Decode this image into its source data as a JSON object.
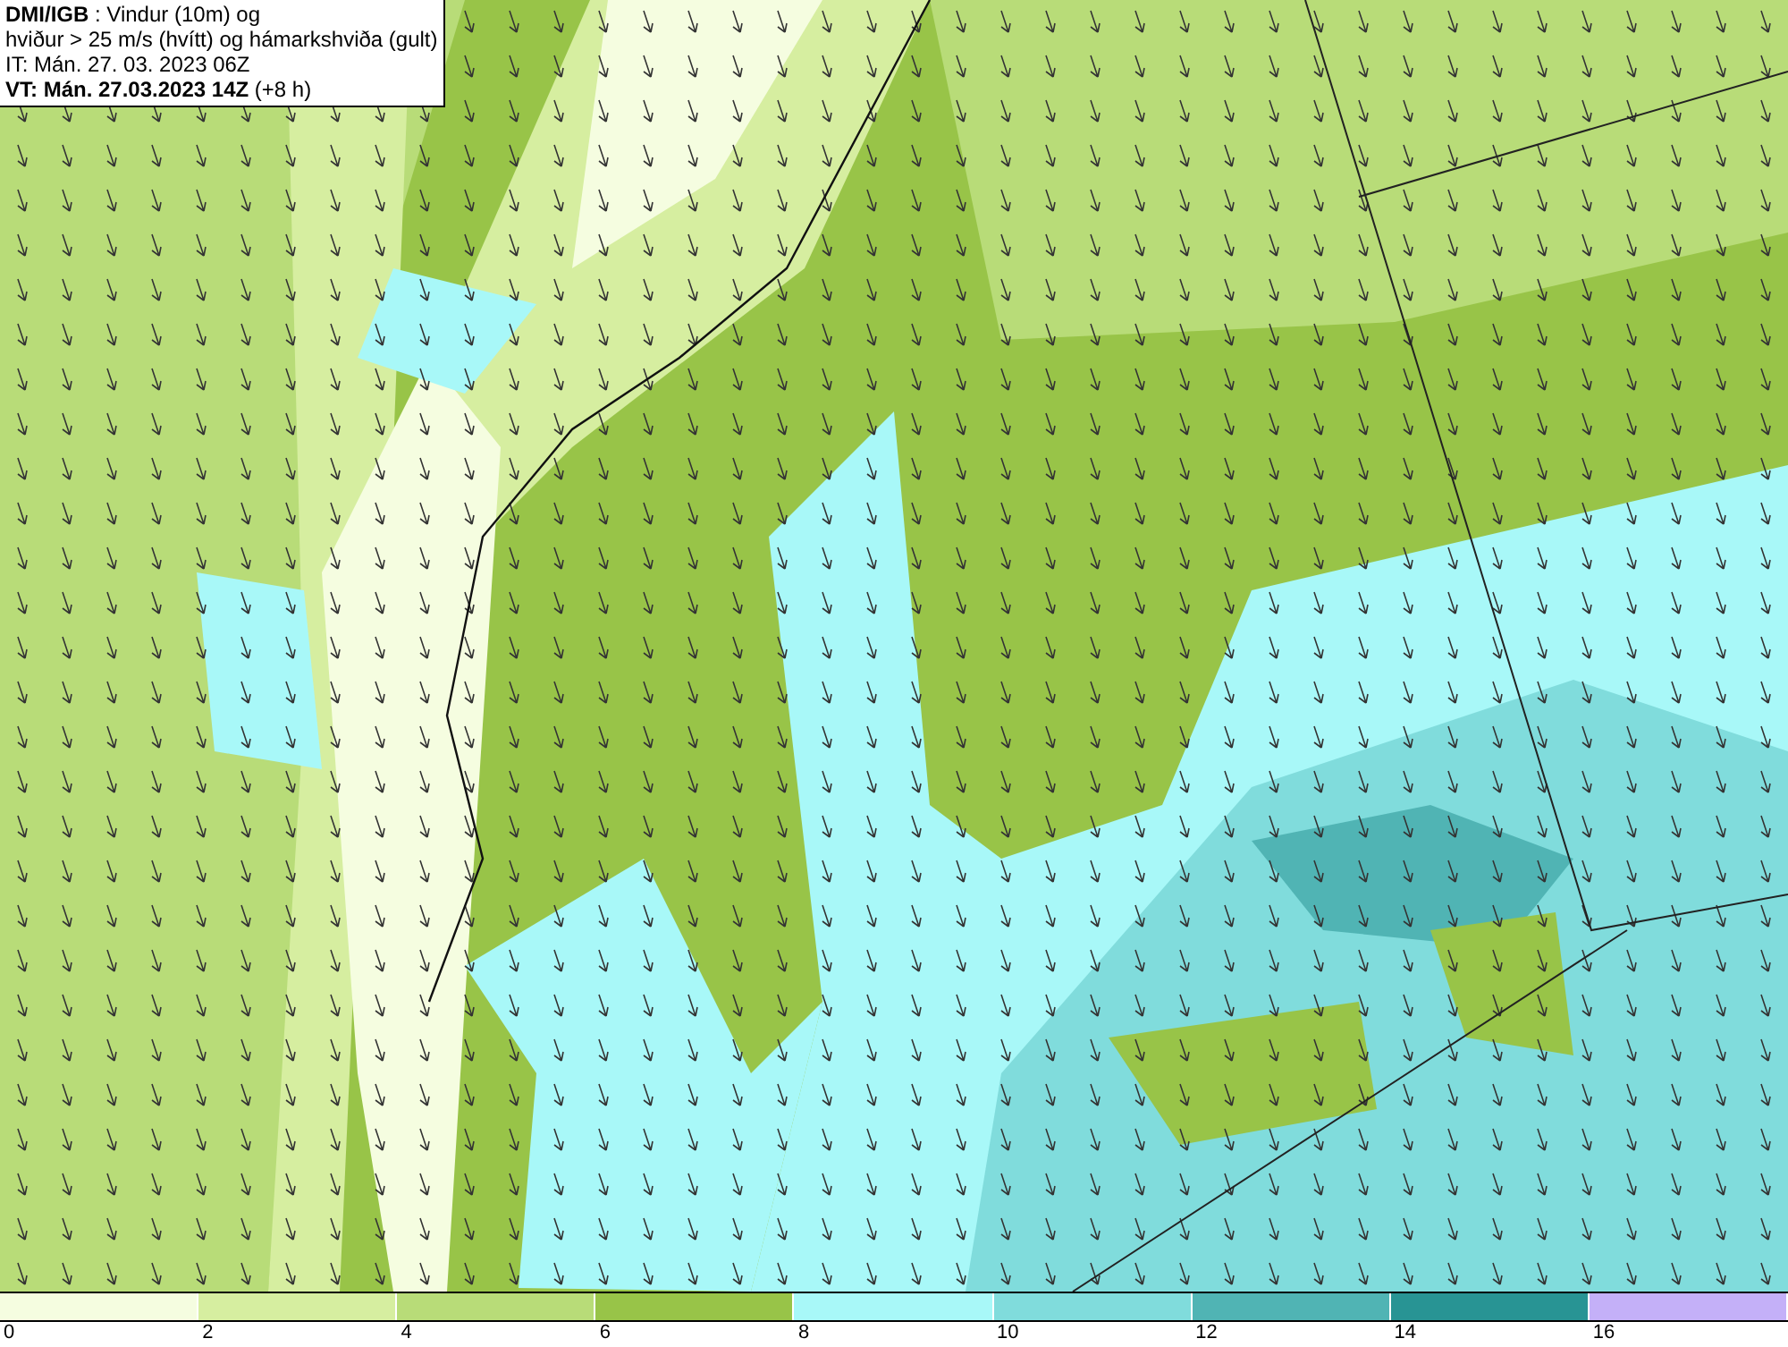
{
  "map": {
    "caption": [
      "**DMI/IGB** : Vindur (10m) og",
      "hviður > 25 m/s (hvítt) og hámarkshviða (gult)",
      "IT: Mán. 27. 03. 2023 06Z",
      "**VT: Mán. 27.03.2023 14Z** (+8 h)"
    ]
  },
  "legend": {
    "bins": [
      {
        "color": "#f5fde0"
      },
      {
        "color": "#d6eea0"
      },
      {
        "color": "#b8dc78"
      },
      {
        "color": "#98c448"
      },
      {
        "color": "#a8f8f8"
      },
      {
        "color": "#80dcdc"
      },
      {
        "color": "#50b4b4"
      },
      {
        "color": "#289494"
      },
      {
        "color": "#c4b0f8"
      }
    ],
    "ticks": [
      "0",
      "2",
      "4",
      "6",
      "8",
      "10",
      "12",
      "14",
      "16"
    ]
  }
}
